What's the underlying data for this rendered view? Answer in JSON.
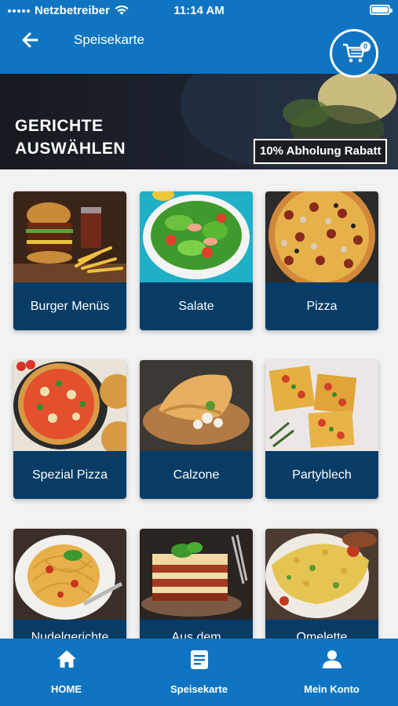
{
  "status_bar": {
    "carrier": "Netzbetreiber",
    "time": "11:14 AM"
  },
  "header": {
    "title": "Speisekarte",
    "cart_count": "0"
  },
  "hero": {
    "title_line1": "GERICHTE",
    "title_line2": "AUSWÄHLEN",
    "badge": "10% Abholung Rabatt"
  },
  "categories": [
    {
      "label": "Burger Menüs"
    },
    {
      "label": "Salate"
    },
    {
      "label": "Pizza"
    },
    {
      "label": "Spezial Pizza"
    },
    {
      "label": "Calzone"
    },
    {
      "label": "Partyblech"
    },
    {
      "label": "Nudelgerichte"
    },
    {
      "label": "Aus dem"
    },
    {
      "label": "Omelette"
    }
  ],
  "bottom_nav": [
    {
      "label": "HOME",
      "icon": "home-icon"
    },
    {
      "label": "Speisekarte",
      "icon": "menu-book-icon"
    },
    {
      "label": "Mein Konto",
      "icon": "account-icon"
    }
  ],
  "colors": {
    "primary": "#0f75c2",
    "card_label": "#063c66",
    "background": "#f2f2f2"
  }
}
